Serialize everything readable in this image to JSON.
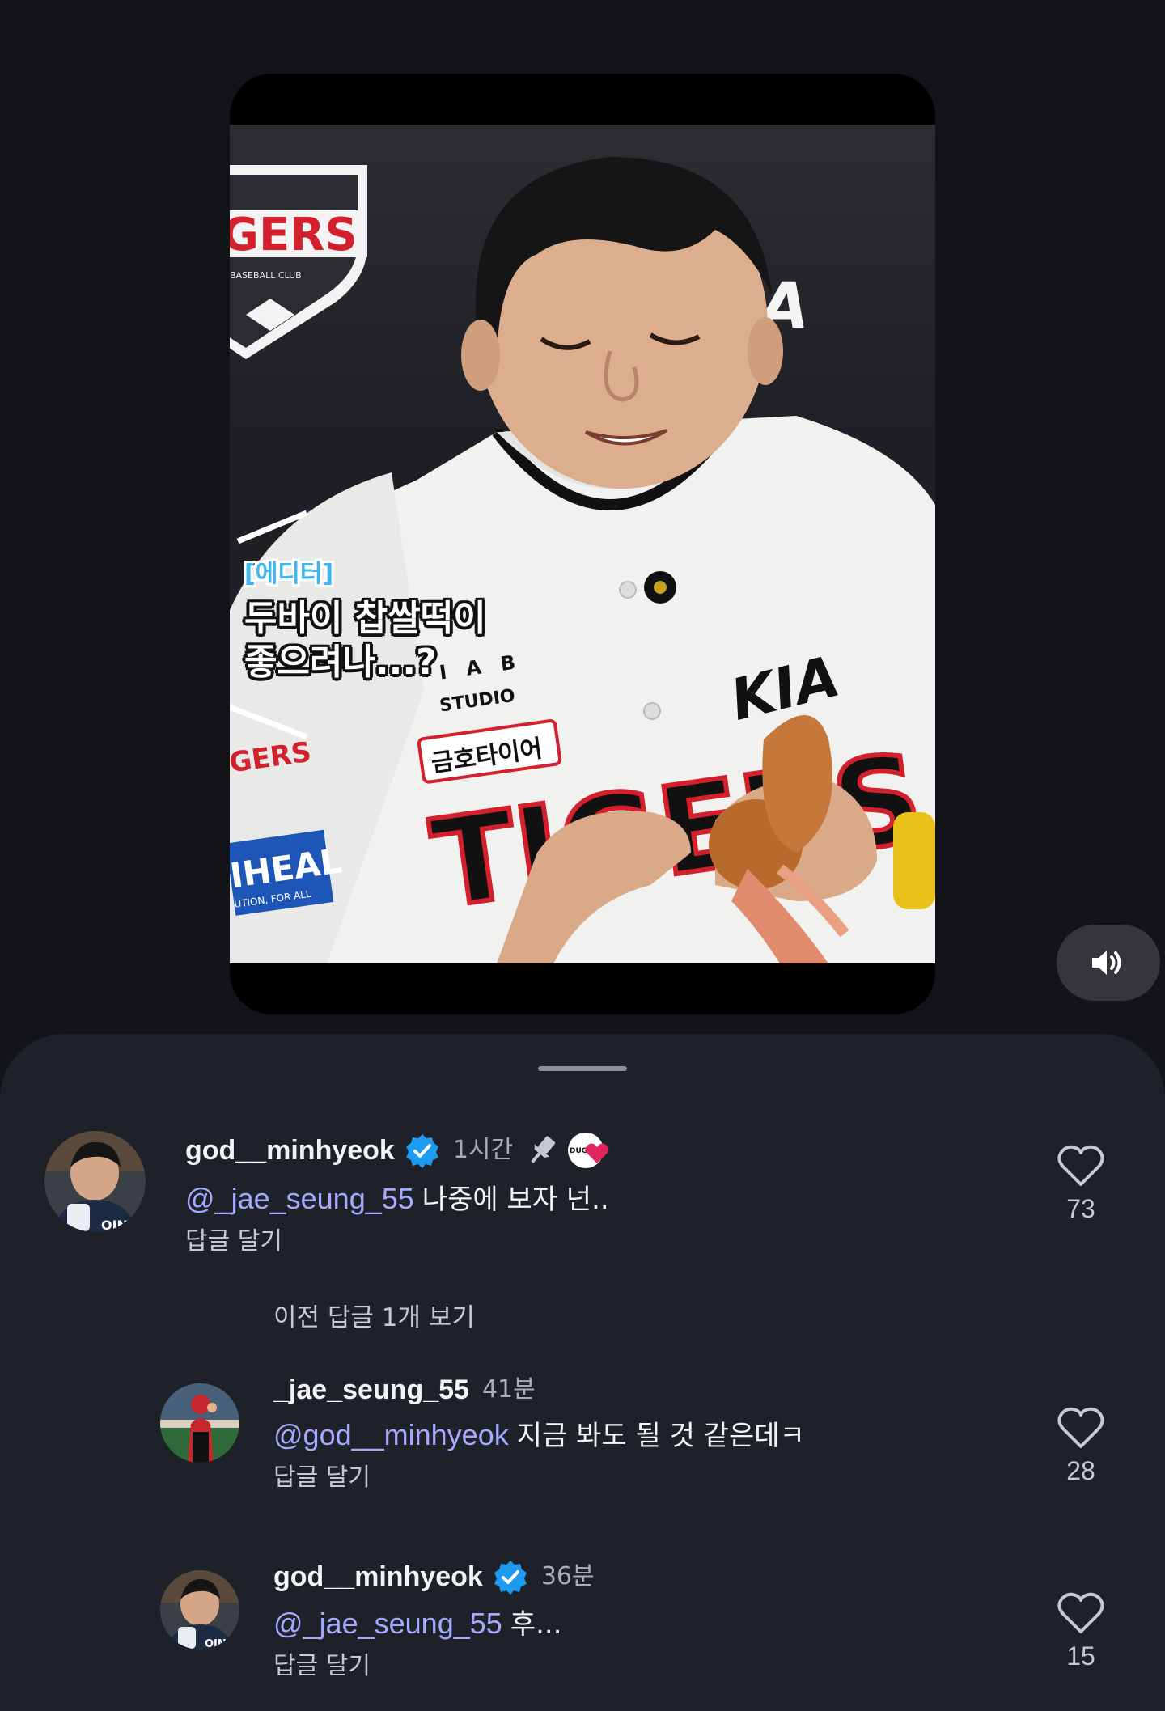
{
  "video": {
    "caption_tag": "[에디터]",
    "caption_line1": "두바이 찹쌀떡이",
    "caption_line2": "좋으려나...?",
    "backdrop_logo_text": "GERS",
    "backdrop_logo_sub": "BASEBALL CLUB",
    "kia_text": "KIA",
    "jersey_patch_studio_top": "I A B",
    "jersey_patch_studio_bottom": "STUDIO",
    "jersey_patch_sponsor": "금호타이어",
    "jersey_wordmark": "TIGERS",
    "sleeve_patch": "IHEAL",
    "sleeve_patch_sub": "UTION, FOR ALL"
  },
  "controls": {
    "speaker_icon": "volume-on-icon"
  },
  "comments": [
    {
      "username": "god__minhyeok",
      "verified": true,
      "time": "1시간",
      "pinned": true,
      "creator_liked": true,
      "mention": "@_jae_seung_55",
      "text": "나중에 보자 넌..",
      "reply_label": "답글 달기",
      "likes": "73"
    },
    {
      "username": "_jae_seung_55",
      "verified": false,
      "time": "41분",
      "mention": "@god__minhyeok",
      "text": "지금 봐도 될 것 같은데ㅋ",
      "reply_label": "답글 달기",
      "likes": "28"
    },
    {
      "username": "god__minhyeok",
      "verified": true,
      "time": "36분",
      "mention": "@_jae_seung_55",
      "text": "후...",
      "reply_label": "답글 달기",
      "likes": "15"
    }
  ],
  "view_previous_replies": "이전 답글 1개 보기",
  "colors": {
    "background": "#121418",
    "sheet": "#1f2128",
    "mention": "#a4a8ff",
    "verified": "#1d9bf0"
  }
}
